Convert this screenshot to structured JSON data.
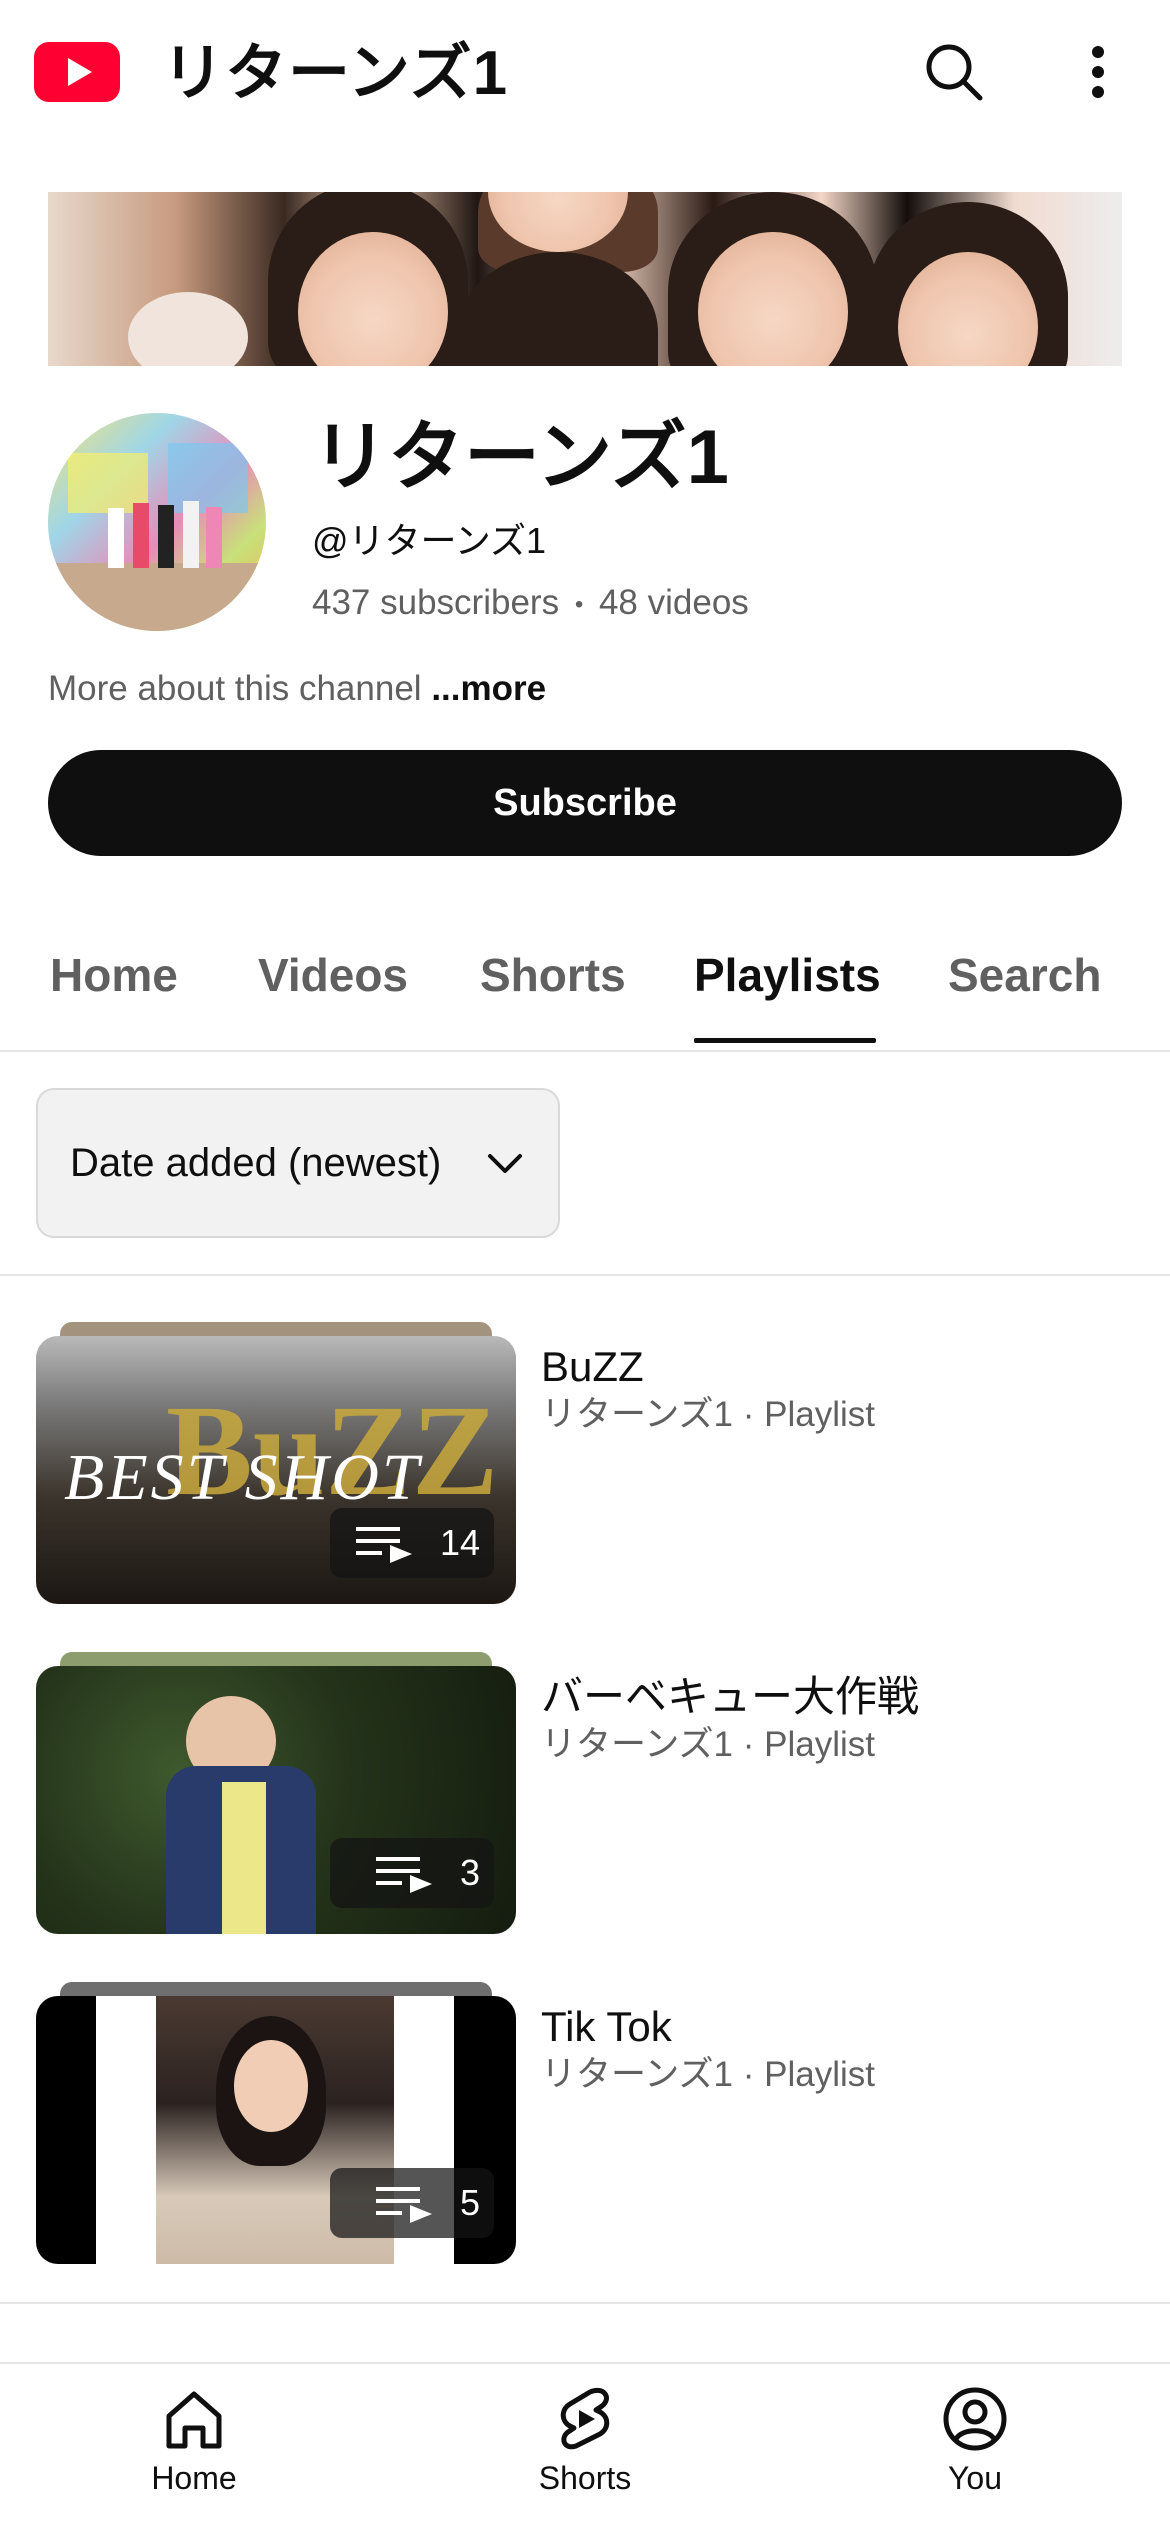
{
  "header": {
    "title": "リターンズ1",
    "logo_icon": "youtube-logo",
    "search_icon": "search-icon",
    "more_icon": "more-vert-icon",
    "brand_color": "#ff0033"
  },
  "channel": {
    "name": "リターンズ1",
    "handle": "@リターンズ1",
    "subscribers": "437 subscribers",
    "videos": "48 videos",
    "separator": "•",
    "about_text": "More about this channel",
    "about_more": "...more",
    "subscribe_label": "Subscribe"
  },
  "tabs": [
    {
      "label": "Home",
      "active": false
    },
    {
      "label": "Videos",
      "active": false
    },
    {
      "label": "Shorts",
      "active": false
    },
    {
      "label": "Playlists",
      "active": true
    },
    {
      "label": "Search",
      "active": false
    }
  ],
  "sort": {
    "label": "Date added (newest)",
    "icon": "chevron-down-icon"
  },
  "playlists": [
    {
      "title": "BuZZ",
      "meta": "リターンズ1 · Playlist",
      "count": "14",
      "overlay_text": "BEST SHOT"
    },
    {
      "title": "バーベキュー大作戦",
      "meta": "リターンズ1 · Playlist",
      "count": "3"
    },
    {
      "title": "Tik Tok",
      "meta": "リターンズ1 · Playlist",
      "count": "5"
    }
  ],
  "bottom_nav": [
    {
      "label": "Home",
      "icon": "home-icon"
    },
    {
      "label": "Shorts",
      "icon": "shorts-icon"
    },
    {
      "label": "You",
      "icon": "account-circle-icon"
    }
  ]
}
